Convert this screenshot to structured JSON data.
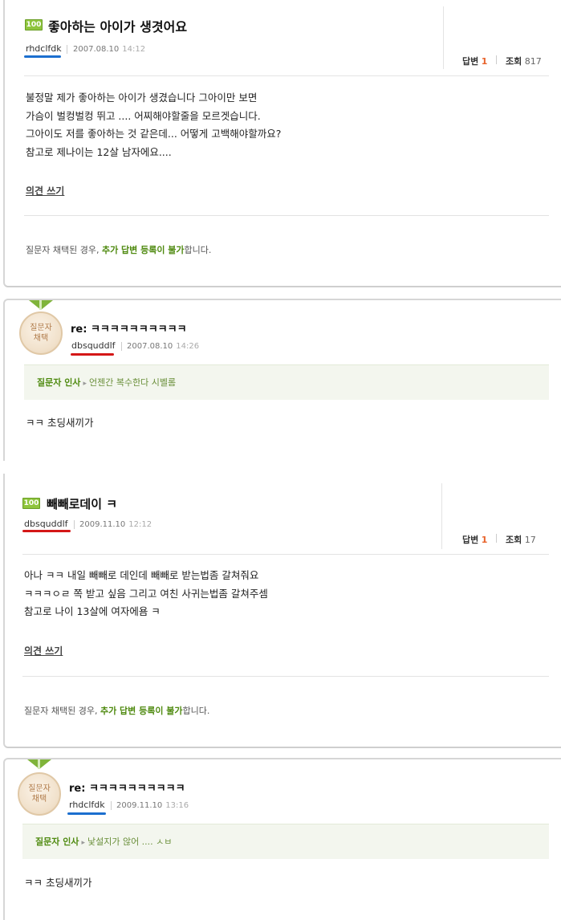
{
  "question1": {
    "badge": "100",
    "title": "좋아하는 아이가 생겻어요",
    "author": "rhdclfdk",
    "date": "2007.08.10",
    "time": "14:12",
    "answers_label": "답변",
    "answers_count": "1",
    "views_label": "조회",
    "views_count": "817",
    "body_lines": [
      "불정말 제가 좋아하는 아이가 생겼습니다 그아이만 보면",
      "가슴이 벌컹벌컹 뛰고 .... 어찌해야할줄을 모르겟습니다.",
      "그아이도 저를 좋아하는 것 같은데... 어떻게 고백해야할까요?",
      "참고로 제나이는 12살 남자에요...."
    ],
    "opinion_link": "의견 쓰기",
    "notice_prefix": "질문자 채택된 경우,",
    "notice_highlight": "추가 답변 등록이 불가",
    "notice_suffix": "합니다."
  },
  "answer1": {
    "medal_line1": "질문자",
    "medal_line2": "채택",
    "title": "re: ㅋㅋㅋㅋㅋㅋㅋㅋㅋㅋ",
    "author": "dbsquddlf",
    "date": "2007.08.10",
    "time": "14:26",
    "greet_label": "질문자 인사",
    "greet_arrow": "▸",
    "greet_message": "언젠간 복수한다 시벨롬",
    "text": "ㅋㅋ 초딩새끼가"
  },
  "question2": {
    "badge": "100",
    "title": "빼빼로데이 ㅋ",
    "author": "dbsquddlf",
    "date": "2009.11.10",
    "time": "12:12",
    "answers_label": "답변",
    "answers_count": "1",
    "views_label": "조회",
    "views_count": "17",
    "body_lines": [
      "아나 ㅋㅋ 내일 빼빼로 데인데 빼빼로 받는법좀 갈쳐줘요",
      "ㅋㅋㅋㅇㄹ 쪽 받고 싶음 그리고 여친 사귀는법좀 갈쳐주셈",
      "참고로 나이 13살에 여자에욤 ㅋ"
    ],
    "opinion_link": "의견 쓰기",
    "notice_prefix": "질문자 채택된 경우,",
    "notice_highlight": "추가 답변 등록이 불가",
    "notice_suffix": "합니다."
  },
  "answer2": {
    "medal_line1": "질문자",
    "medal_line2": "채택",
    "title": "re: ㅋㅋㅋㅋㅋㅋㅋㅋㅋㅋ",
    "author": "rhdclfdk",
    "date": "2009.11.10",
    "time": "13:16",
    "greet_label": "질문자 인사",
    "greet_arrow": "▸",
    "greet_message": "낯설지가 않어 .... ㅅㅂ",
    "text": "ㅋㅋ 초딩새끼가"
  },
  "colors": {
    "accent_green": "#4f8a10",
    "badge_green": "#8fc53d",
    "count_orange": "#e8632b",
    "underline_blue": "#1c6fcf",
    "underline_red": "#d41717"
  }
}
